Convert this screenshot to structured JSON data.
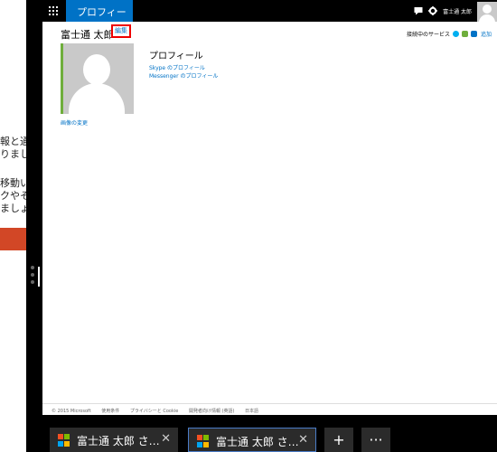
{
  "left_pane": {
    "fragments": [
      "報と通知",
      "りましょ",
      "移動い",
      "クやそ",
      "ましょう"
    ]
  },
  "app": {
    "title": "プロフィール",
    "user_name_short": "富士通 太郎"
  },
  "profile": {
    "name": "富士通 太郎",
    "edit_label": "編集",
    "connected_label": "接続中のサービス",
    "add_label": "追加",
    "change_photo": "画像の変更",
    "section_title": "プロフィール",
    "skype_link": "Skype のプロフィール",
    "messenger_link": "Messenger のプロフィール"
  },
  "footer": {
    "items": [
      "© 2015 Microsoft",
      "使用条件",
      "プライバシーと Cookie",
      "開発者向け情報 (英語)",
      "日本語"
    ]
  },
  "tabs": [
    {
      "title": "富士通 太郎 さ…"
    },
    {
      "title": "富士通 太郎 さ…"
    }
  ],
  "tab_controls": {
    "new": "+",
    "more": "···"
  },
  "colors": {
    "accent": "#0072c6",
    "highlight": "#e00000"
  }
}
